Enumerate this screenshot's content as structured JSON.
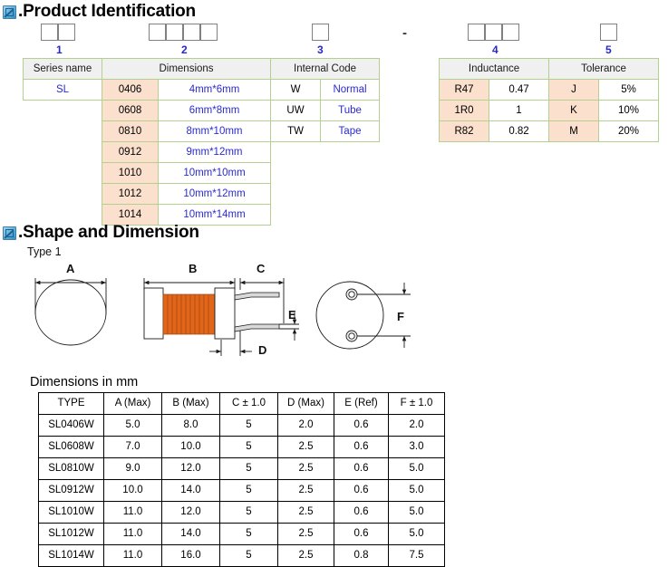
{
  "sections": {
    "product_identification": {
      "icon": "broken-image-icon",
      "title": ".Product Identification",
      "separator": "-",
      "groups": [
        {
          "number": "1",
          "boxes": 2
        },
        {
          "number": "2",
          "boxes": 4
        },
        {
          "number": "3",
          "boxes": 1
        },
        {
          "number": "4",
          "boxes": 3
        },
        {
          "number": "5",
          "boxes": 1
        }
      ],
      "left_table": {
        "headers": [
          "Series name",
          "Dimensions",
          "Internal Code"
        ],
        "series_name": "SL",
        "dimension_rows": [
          {
            "code": "0406",
            "size": "4mm*6mm"
          },
          {
            "code": "0608",
            "size": "6mm*8mm"
          },
          {
            "code": "0810",
            "size": "8mm*10mm"
          },
          {
            "code": "0912",
            "size": "9mm*12mm"
          },
          {
            "code": "1010",
            "size": "10mm*10mm"
          },
          {
            "code": "1012",
            "size": "10mm*12mm"
          },
          {
            "code": "1014",
            "size": "10mm*14mm"
          }
        ],
        "internal_code_rows": [
          {
            "code": "W",
            "desc": "Normal"
          },
          {
            "code": "UW",
            "desc": "Tube"
          },
          {
            "code": "TW",
            "desc": "Tape"
          }
        ]
      },
      "right_table": {
        "headers": [
          "Inductance",
          "Tolerance"
        ],
        "inductance_rows": [
          {
            "code": "R47",
            "value": "0.47"
          },
          {
            "code": "1R0",
            "value": "1"
          },
          {
            "code": "R82",
            "value": "0.82"
          }
        ],
        "tolerance_rows": [
          {
            "code": "J",
            "value": "5%"
          },
          {
            "code": "K",
            "value": "10%"
          },
          {
            "code": "M",
            "value": "20%"
          }
        ]
      }
    },
    "shape_and_dimension": {
      "icon": "broken-image-icon",
      "title": ".Shape and Dimension",
      "type_label": "Type 1",
      "drawing_labels": {
        "a": "A",
        "b": "B",
        "c": "C",
        "d": "D",
        "e": "E",
        "f": "F"
      },
      "dimensions_title": "Dimensions in mm",
      "table": {
        "headers": [
          "TYPE",
          "A (Max)",
          "B (Max)",
          "C ± 1.0",
          "D (Max)",
          "E (Ref)",
          "F ± 1.0"
        ],
        "rows": [
          [
            "SL0406W",
            "5.0",
            "8.0",
            "5",
            "2.0",
            "0.6",
            "2.0"
          ],
          [
            "SL0608W",
            "7.0",
            "10.0",
            "5",
            "2.5",
            "0.6",
            "3.0"
          ],
          [
            "SL0810W",
            "9.0",
            "12.0",
            "5",
            "2.5",
            "0.6",
            "5.0"
          ],
          [
            "SL0912W",
            "10.0",
            "14.0",
            "5",
            "2.5",
            "0.6",
            "5.0"
          ],
          [
            "SL1010W",
            "11.0",
            "12.0",
            "5",
            "2.5",
            "0.6",
            "5.0"
          ],
          [
            "SL1012W",
            "11.0",
            "14.0",
            "5",
            "2.5",
            "0.6",
            "5.0"
          ],
          [
            "SL1014W",
            "11.0",
            "16.0",
            "5",
            "2.5",
            "0.8",
            "7.5"
          ]
        ]
      }
    }
  },
  "colors": {
    "table_border_green": "#b5cf8e",
    "peach_cell": "#fbe0cd",
    "header_gray": "#f0f0f0",
    "blue_text": "#2a2ad0",
    "number_blue": "#2828c8",
    "coil_copper": "#e2661a"
  }
}
